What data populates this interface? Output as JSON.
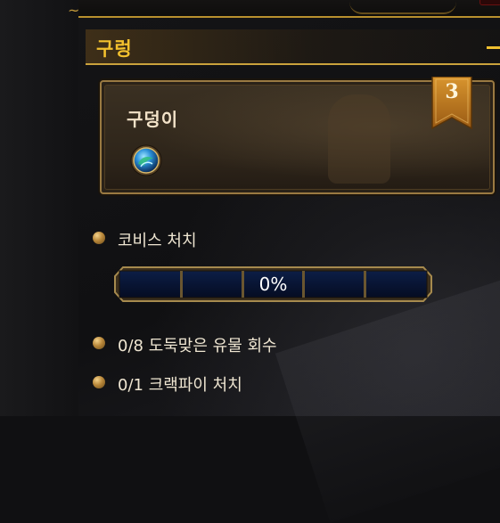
{
  "section": {
    "title": "구렁"
  },
  "boss": {
    "name": "구덩이",
    "difficulty_badge": "3",
    "icon": "boss-orb-icon"
  },
  "objectives": [
    {
      "text": "코비스 처치"
    },
    {
      "text": "0/8 도둑맞은 유물 회수"
    },
    {
      "text": "0/1 크랙파이 처치"
    }
  ],
  "progress": {
    "label": "0%",
    "value": 0
  },
  "colors": {
    "header_gold": "#f3c12e",
    "frame_gold": "#caa23c",
    "bar_fill": "#0a1838"
  }
}
